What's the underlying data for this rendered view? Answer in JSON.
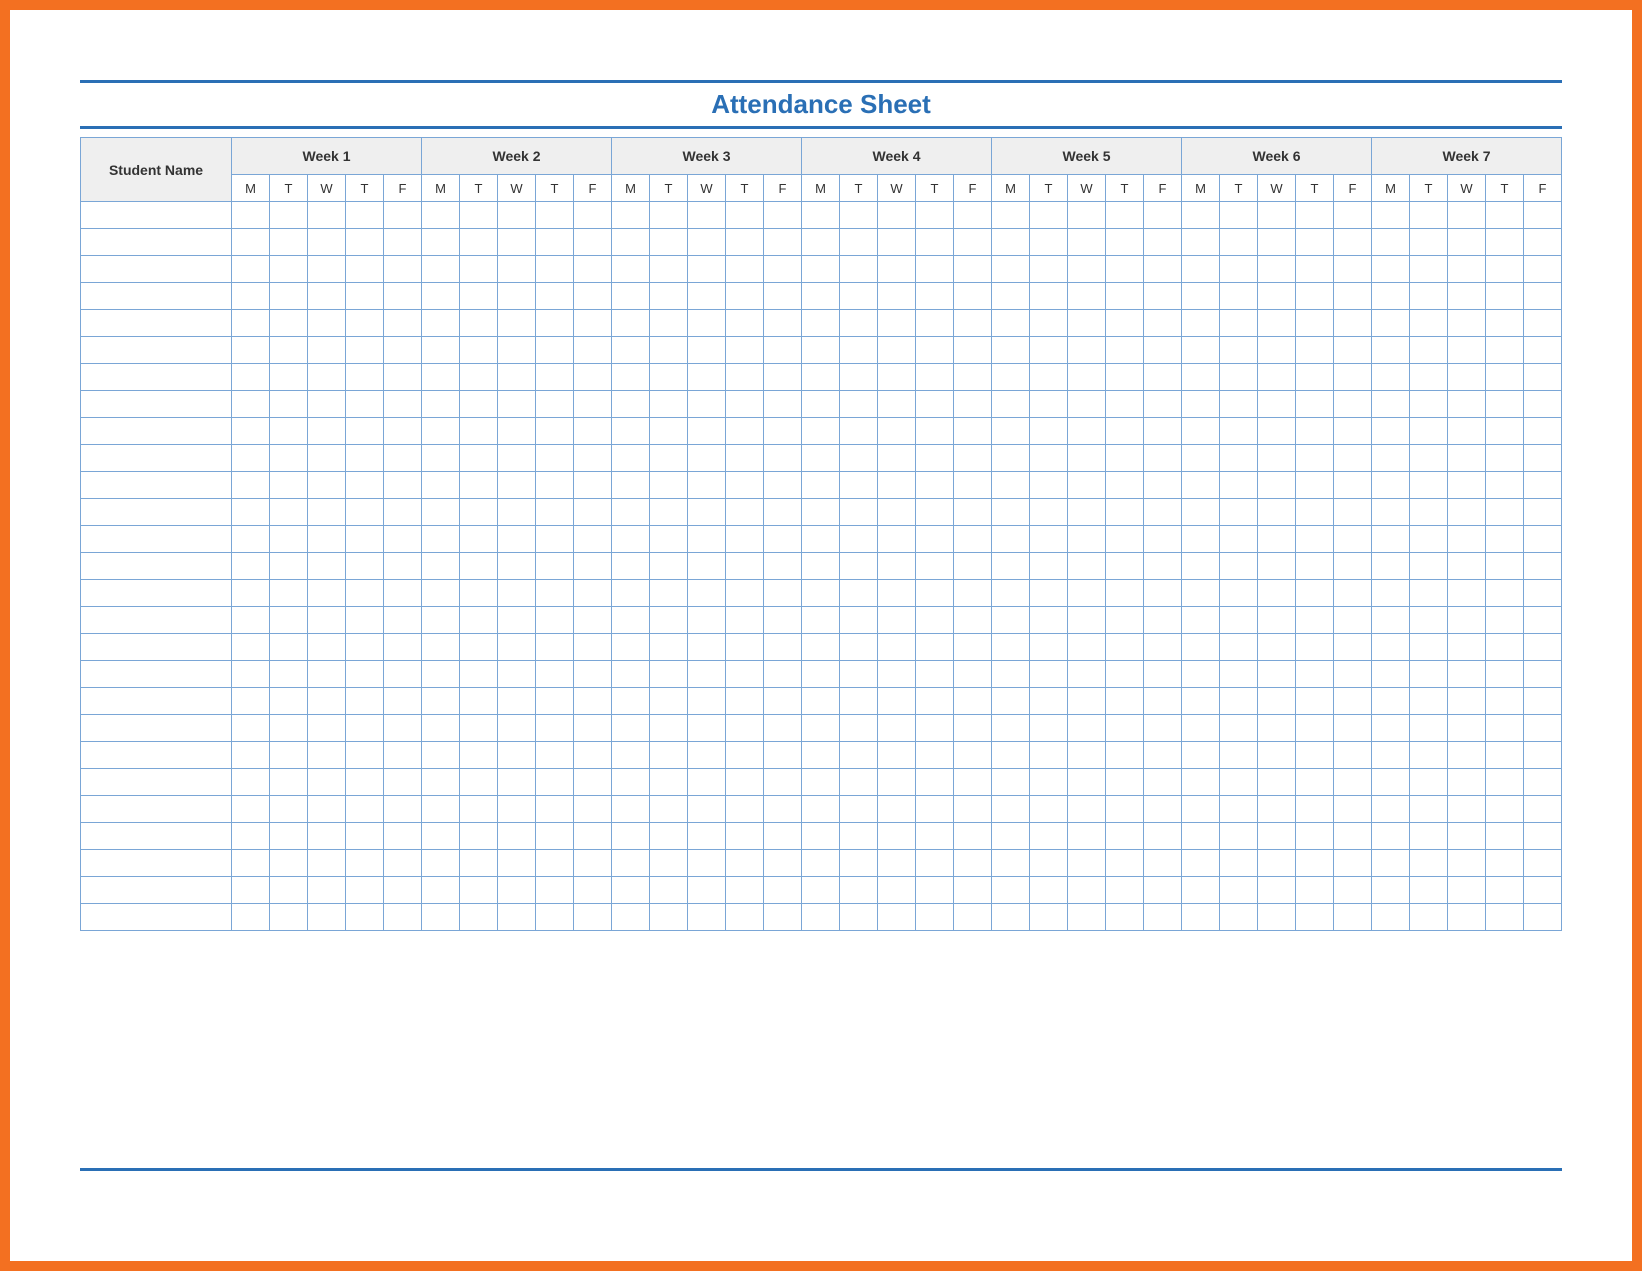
{
  "title": "Attendance Sheet",
  "name_column_header": "Student Name",
  "weeks": [
    {
      "label": "Week 1",
      "days": [
        "M",
        "T",
        "W",
        "T",
        "F"
      ]
    },
    {
      "label": "Week 2",
      "days": [
        "M",
        "T",
        "W",
        "T",
        "F"
      ]
    },
    {
      "label": "Week 3",
      "days": [
        "M",
        "T",
        "W",
        "T",
        "F"
      ]
    },
    {
      "label": "Week 4",
      "days": [
        "M",
        "T",
        "W",
        "T",
        "F"
      ]
    },
    {
      "label": "Week 5",
      "days": [
        "M",
        "T",
        "W",
        "T",
        "F"
      ]
    },
    {
      "label": "Week 6",
      "days": [
        "M",
        "T",
        "W",
        "T",
        "F"
      ]
    },
    {
      "label": "Week 7",
      "days": [
        "M",
        "T",
        "W",
        "T",
        "F"
      ]
    }
  ],
  "row_count": 27,
  "colors": {
    "frame": "#f37021",
    "accent": "#2a6fb5",
    "grid": "#7aa6d6",
    "header_bg": "#efefef"
  }
}
